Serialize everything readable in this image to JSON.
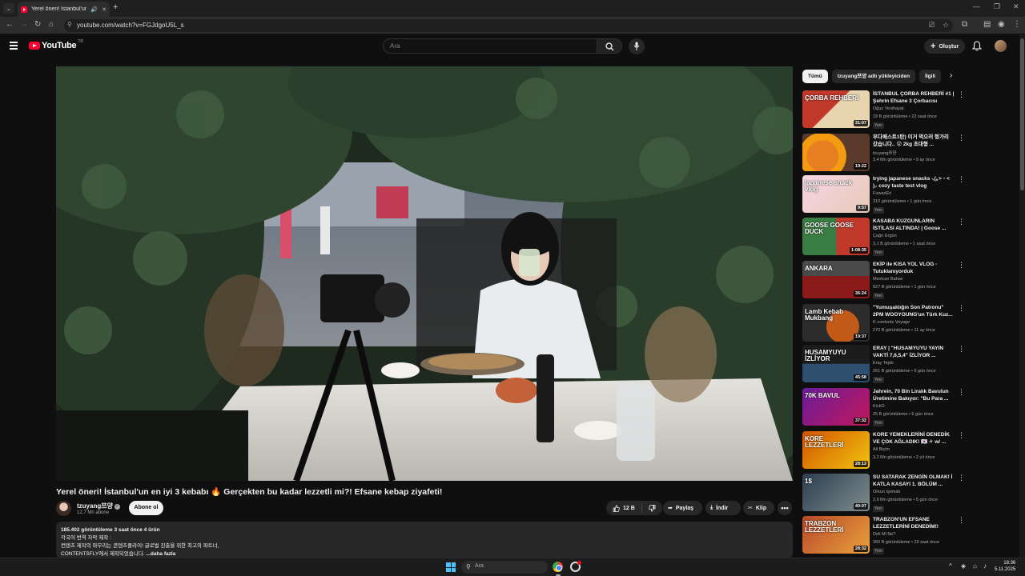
{
  "browser": {
    "tab_title": "Yerel öneri! İstanbul'un en iyi 3",
    "url": "youtube.com/watch?v=FGJdgoU5L_s"
  },
  "masthead": {
    "logo": "YouTube",
    "country": "TR",
    "search_placeholder": "Ara",
    "create_label": "Oluştur"
  },
  "video": {
    "title": "Yerel öneri! İstanbul'un en iyi 3 kebabı 🔥 Gerçekten bu kadar lezzetli mi?! Efsane kebap ziyafeti!",
    "channel": "tzuyang쯔양",
    "subscribers": "12,7 Mn abone",
    "subscribe_label": "Abone ol",
    "likes": "12 B",
    "share_label": "Paylaş",
    "download_label": "İndir",
    "clip_label": "Klip",
    "description": {
      "stats": "185.402 görüntüleme  3 saat önce  4 ürün",
      "line1": "각국어 번역 자막 제작 :",
      "line2": "컨텐츠 제작의 마무리는 콘텐츠플라이! 글로벌 진출을 위한 최고의 파트너,",
      "line3": "CONTENTSFLY에서 제작되었습니다.",
      "more": "...daha fazla"
    }
  },
  "sidebar": {
    "chips": [
      "Tümü",
      "tzuyang쯔양 adlı yükleyiciden",
      "İlgili"
    ],
    "recommendations": [
      {
        "title": "İSTANBUL ÇORBA REHBERİ #1 | Şehrin Efsane 3 Çorbacısı",
        "channel": "Oğuz Yenihayat",
        "meta": "19 B görüntüleme • 22 saat önce",
        "duration": "31:07",
        "badge": "Yeni",
        "thumb_text": "ÇORBA REHBERİ"
      },
      {
        "title": "부다페스트1탄) 이거 먹으러 헝가리 갔습니다.. 😲 2kg 초대형 ...",
        "channel": "tzuyang쯔양",
        "meta": "3,4 Mn görüntüleme • 9 ay önce",
        "duration": "19:22",
        "badge": "",
        "thumb_text": ""
      },
      {
        "title": "trying japanese snacks ⸜(｡˃ ᵕ ˂ )⸝ cozy taste test vlog",
        "channel": "FuwariEri",
        "meta": "310 görüntüleme • 1 gün önce",
        "duration": "9:57",
        "badge": "Yeni",
        "thumb_text": "japanese snack vlog"
      },
      {
        "title": "KASABA KUZGUNLARIN İSTİLASI ALTINDA! | Goose ...",
        "channel": "Çağrı Ergün",
        "meta": "3,1 B görüntüleme • 1 saat önce",
        "duration": "1:08:35",
        "badge": "Yeni",
        "thumb_text": "GOOSE GOOSE DUCK"
      },
      {
        "title": "EKİP ile KISA YOL VLOG - Tutuklanıyorduk",
        "channel": "Mevlcan Bahav",
        "meta": "927 B görüntüleme • 1 gün önce",
        "duration": "36:24",
        "badge": "Yeni",
        "thumb_text": "ANKARA"
      },
      {
        "title": "\"Yumuşaklığın Son Patronu\" 2PM WOOYOUNG'un Türk Kuz...",
        "channel": "K-contents Voyage",
        "meta": "270 B görüntüleme • 11 ay önce",
        "duration": "19:37",
        "badge": "",
        "thumb_text": "Lamb Kebab Mukbang"
      },
      {
        "title": "ERAY | \"HUSAMYUYU YAYIN VAKTİ 7,6,5,4\" İZLİYOR ...",
        "channel": "Eray Tepki",
        "meta": "261 B görüntüleme • 6 gün önce",
        "duration": "45:58",
        "badge": "Yeni",
        "thumb_text": "HUSAMYUYU İZLİYOR"
      },
      {
        "title": "Jahrein, 70 Bin Liralık Bavulun Üretimine Bakıyor: \"Bu Para ...",
        "channel": "KickO",
        "meta": "25 B görüntüleme • 6 gün önce",
        "duration": "37:32",
        "badge": "Yeni",
        "thumb_text": "70K BAVUL"
      },
      {
        "title": "KORE YEMEKLERİNİ DENEDİK VE ÇOK AĞLADIK! 🇰🇷 ✈ w/ ...",
        "channel": "Ali Biçim",
        "meta": "3,2 Mn görüntüleme • 2 yıl önce",
        "duration": "28:13",
        "badge": "",
        "thumb_text": "KORE LEZZETLERİ"
      },
      {
        "title": "SU SATARAK ZENGİN OLMAK! İ KATLA KASAYI 1. BÖLÜM ...",
        "channel": "Orkun Işıtmak",
        "meta": "2,9 Mn görüntüleme • 5 gün önce",
        "duration": "40:07",
        "badge": "Yeni",
        "thumb_text": "1$"
      },
      {
        "title": "TRABZON'UN EFSANE LEZZETLERİNİ DENEDİM!!",
        "channel": "Deli Mi Ne?",
        "meta": "360 B görüntüleme • 23 saat önce",
        "duration": "28:32",
        "badge": "Yeni",
        "thumb_text": "TRABZON LEZZETLERİ"
      }
    ]
  },
  "taskbar": {
    "search_placeholder": "Ara",
    "time": "18:36",
    "date": "5.11.2025"
  },
  "colors": {
    "background": "#0f0f0f",
    "brand_red": "#ff0033",
    "surface": "#272727",
    "muted_text": "#aaaaaa"
  }
}
